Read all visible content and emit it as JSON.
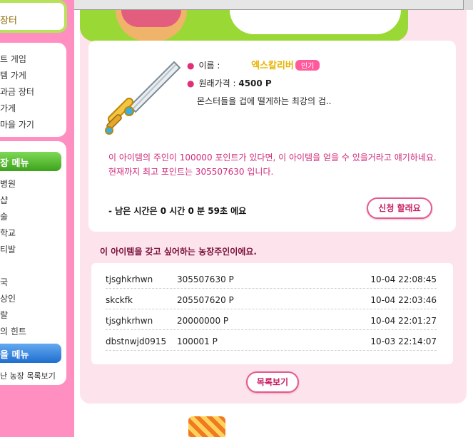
{
  "sidebar": {
    "top_label": "장터",
    "menu1_items": [
      "트 게임",
      "템 가게",
      "과금 장터",
      "가게",
      "마을 가기"
    ],
    "menu2_title": "장 메뉴",
    "menu2_items": [
      "병원",
      "샵",
      "술",
      "학교",
      "티발",
      "",
      "국",
      "상인",
      "랄",
      "의 힌트"
    ],
    "menu3_title": "을 메뉴",
    "menu3_items": [
      "난 농장 목록보기"
    ]
  },
  "item": {
    "name_label": "이름 :",
    "name": "엑스칼리버",
    "badge": "인기",
    "price_label": "원래가격 :",
    "price": "4500 P",
    "description": "몬스터들을 겁에 떨게하는 최강의 검..",
    "notice_line1": "이 아이템의 주인이 100000 포인트가 있다면, 이 아이템을 얻을 수 있을거라고 얘기하네요.",
    "notice_line2": "현재까지 최고 포인트는 305507630 입니다.",
    "remaining_time": "- 남은 시간은 0 시간 0 분 59초 에요",
    "apply_button": "신청 할래요"
  },
  "bids": {
    "title": "이 아이템을 갖고 싶어하는 농장주인이에요.",
    "rows": [
      {
        "user": "tjsghkrhwn",
        "points": "305507630 P",
        "time": "10-04 22:08:45"
      },
      {
        "user": "skckfk",
        "points": "205507620 P",
        "time": "10-04 22:03:46"
      },
      {
        "user": "tjsghkrhwn",
        "points": "20000000 P",
        "time": "10-04 22:01:27"
      },
      {
        "user": "dbstnwjd0915",
        "points": "100001 P",
        "time": "10-03 22:14:07"
      }
    ],
    "list_button": "목록보기"
  },
  "icons": [
    "sword-icon",
    "bullet-icon",
    "basket-icon"
  ],
  "colors": {
    "sidebar_bg": "#ff8fc0",
    "panel_bg": "#fde3ec",
    "accent_pink": "#e35b8e",
    "notice_text": "#d02b7a",
    "name_gold": "#e6b400"
  }
}
